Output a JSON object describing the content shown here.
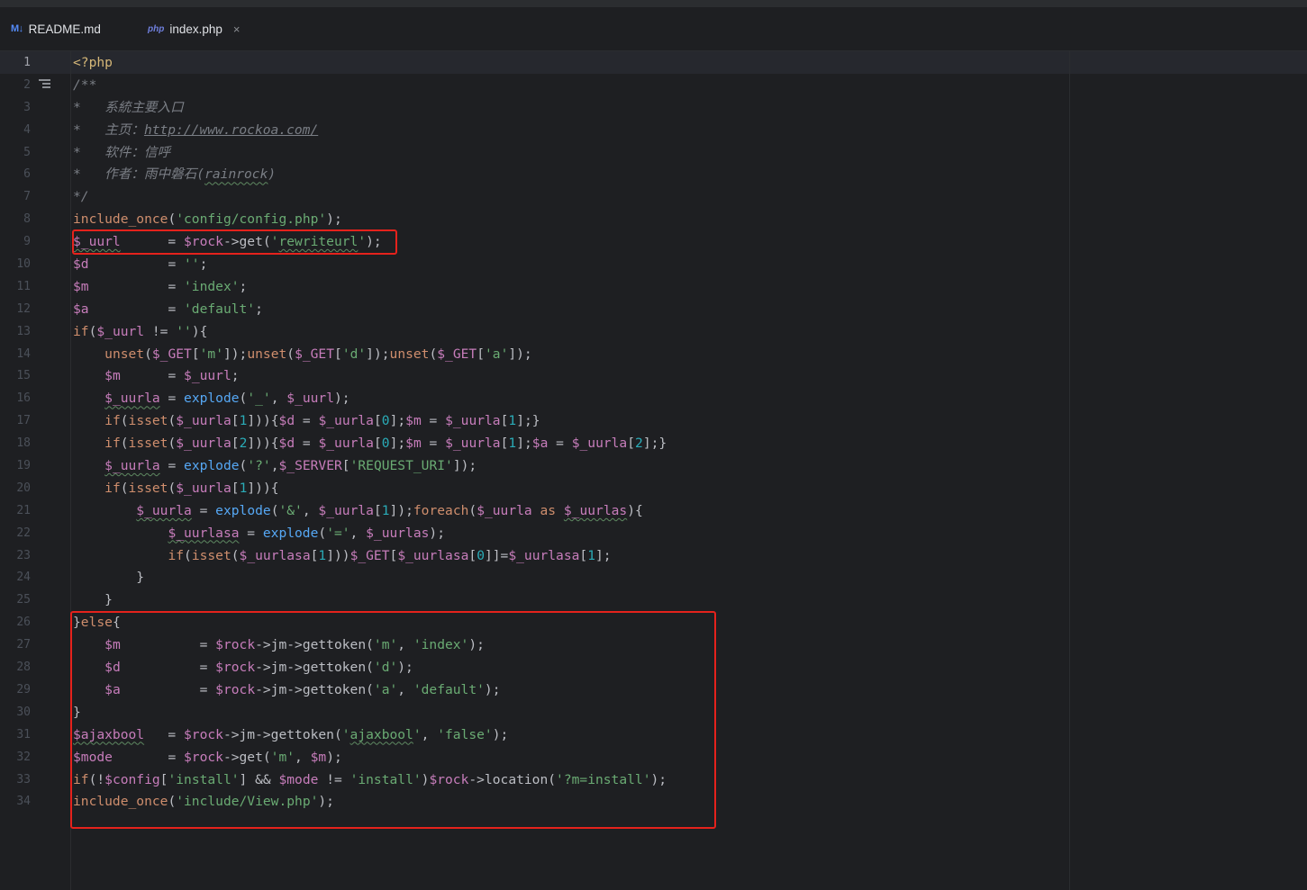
{
  "tabs": [
    {
      "icon": "M↓",
      "label": "README.md",
      "active": false
    },
    {
      "icon": "php",
      "label": "index.php",
      "active": true,
      "close": "×"
    }
  ],
  "editor": {
    "current_line": 1,
    "lines": [
      {
        "n": "1",
        "tokens": [
          [
            "tag",
            "<?php"
          ]
        ]
      },
      {
        "n": "2",
        "fold": true,
        "tokens": [
          [
            "com",
            "/**"
          ]
        ]
      },
      {
        "n": "3",
        "tokens": [
          [
            "com",
            "*   系統主要入口"
          ]
        ]
      },
      {
        "n": "4",
        "tokens": [
          [
            "com",
            "*   主页："
          ],
          [
            "link",
            "http://www.rockoa.com/"
          ]
        ]
      },
      {
        "n": "5",
        "tokens": [
          [
            "com",
            "*   软件：信呼"
          ]
        ]
      },
      {
        "n": "6",
        "tokens": [
          [
            "com",
            "*   作者：雨中磐石("
          ],
          [
            "linkplain",
            "rainrock"
          ],
          [
            "com",
            ")"
          ]
        ]
      },
      {
        "n": "7",
        "tokens": [
          [
            "com",
            "*/"
          ]
        ]
      },
      {
        "n": "8",
        "tokens": [
          [
            "kw",
            "include_once"
          ],
          [
            "p",
            "("
          ],
          [
            "str",
            "'config/config.php'"
          ],
          [
            "p",
            ");"
          ]
        ]
      },
      {
        "n": "9",
        "tokens": [
          [
            "vsq",
            "$_uurl"
          ],
          [
            "p",
            "      = "
          ],
          [
            "var",
            "$rock"
          ],
          [
            "p",
            "->get("
          ],
          [
            "str",
            "'"
          ],
          [
            "strsq",
            "rewriteurl"
          ],
          [
            "str",
            "'"
          ],
          [
            "p",
            ");"
          ]
        ]
      },
      {
        "n": "10",
        "tokens": [
          [
            "var",
            "$d"
          ],
          [
            "p",
            "          = "
          ],
          [
            "str",
            "''"
          ],
          [
            "p",
            ";"
          ]
        ]
      },
      {
        "n": "11",
        "tokens": [
          [
            "var",
            "$m"
          ],
          [
            "p",
            "          = "
          ],
          [
            "str",
            "'index'"
          ],
          [
            "p",
            ";"
          ]
        ]
      },
      {
        "n": "12",
        "tokens": [
          [
            "var",
            "$a"
          ],
          [
            "p",
            "          = "
          ],
          [
            "str",
            "'default'"
          ],
          [
            "p",
            ";"
          ]
        ]
      },
      {
        "n": "13",
        "tokens": [
          [
            "kw",
            "if"
          ],
          [
            "p",
            "("
          ],
          [
            "var",
            "$_uurl"
          ],
          [
            "p",
            " != "
          ],
          [
            "str",
            "''"
          ],
          [
            "p",
            "){"
          ]
        ]
      },
      {
        "n": "14",
        "tokens": [
          [
            "p",
            "    "
          ],
          [
            "kw",
            "unset"
          ],
          [
            "p",
            "("
          ],
          [
            "var",
            "$_GET"
          ],
          [
            "p",
            "["
          ],
          [
            "str",
            "'m'"
          ],
          [
            "p",
            "]);"
          ],
          [
            "kw",
            "unset"
          ],
          [
            "p",
            "("
          ],
          [
            "var",
            "$_GET"
          ],
          [
            "p",
            "["
          ],
          [
            "str",
            "'d'"
          ],
          [
            "p",
            "]);"
          ],
          [
            "kw",
            "unset"
          ],
          [
            "p",
            "("
          ],
          [
            "var",
            "$_GET"
          ],
          [
            "p",
            "["
          ],
          [
            "str",
            "'a'"
          ],
          [
            "p",
            "]);"
          ]
        ]
      },
      {
        "n": "15",
        "tokens": [
          [
            "p",
            "    "
          ],
          [
            "var",
            "$m"
          ],
          [
            "p",
            "      = "
          ],
          [
            "var",
            "$_uurl"
          ],
          [
            "p",
            ";"
          ]
        ]
      },
      {
        "n": "16",
        "tokens": [
          [
            "p",
            "    "
          ],
          [
            "vsq",
            "$_uurla"
          ],
          [
            "p",
            " = "
          ],
          [
            "fn",
            "explode"
          ],
          [
            "p",
            "("
          ],
          [
            "str",
            "'_'"
          ],
          [
            "p",
            ", "
          ],
          [
            "var",
            "$_uurl"
          ],
          [
            "p",
            ");"
          ]
        ]
      },
      {
        "n": "17",
        "tokens": [
          [
            "p",
            "    "
          ],
          [
            "kw",
            "if"
          ],
          [
            "p",
            "("
          ],
          [
            "kw",
            "isset"
          ],
          [
            "p",
            "("
          ],
          [
            "var",
            "$_uurla"
          ],
          [
            "p",
            "["
          ],
          [
            "num",
            "1"
          ],
          [
            "p",
            "])){"
          ],
          [
            "var",
            "$d"
          ],
          [
            "p",
            " = "
          ],
          [
            "var",
            "$_uurla"
          ],
          [
            "p",
            "["
          ],
          [
            "num",
            "0"
          ],
          [
            "p",
            "];"
          ],
          [
            "var",
            "$m"
          ],
          [
            "p",
            " = "
          ],
          [
            "var",
            "$_uurla"
          ],
          [
            "p",
            "["
          ],
          [
            "num",
            "1"
          ],
          [
            "p",
            "];}"
          ]
        ]
      },
      {
        "n": "18",
        "tokens": [
          [
            "p",
            "    "
          ],
          [
            "kw",
            "if"
          ],
          [
            "p",
            "("
          ],
          [
            "kw",
            "isset"
          ],
          [
            "p",
            "("
          ],
          [
            "var",
            "$_uurla"
          ],
          [
            "p",
            "["
          ],
          [
            "num",
            "2"
          ],
          [
            "p",
            "])){"
          ],
          [
            "var",
            "$d"
          ],
          [
            "p",
            " = "
          ],
          [
            "var",
            "$_uurla"
          ],
          [
            "p",
            "["
          ],
          [
            "num",
            "0"
          ],
          [
            "p",
            "];"
          ],
          [
            "var",
            "$m"
          ],
          [
            "p",
            " = "
          ],
          [
            "var",
            "$_uurla"
          ],
          [
            "p",
            "["
          ],
          [
            "num",
            "1"
          ],
          [
            "p",
            "];"
          ],
          [
            "var",
            "$a"
          ],
          [
            "p",
            " = "
          ],
          [
            "var",
            "$_uurla"
          ],
          [
            "p",
            "["
          ],
          [
            "num",
            "2"
          ],
          [
            "p",
            "];}"
          ]
        ]
      },
      {
        "n": "19",
        "tokens": [
          [
            "p",
            "    "
          ],
          [
            "vsq",
            "$_uurla"
          ],
          [
            "p",
            " = "
          ],
          [
            "fn",
            "explode"
          ],
          [
            "p",
            "("
          ],
          [
            "str",
            "'?'"
          ],
          [
            "p",
            ","
          ],
          [
            "var",
            "$_SERVER"
          ],
          [
            "p",
            "["
          ],
          [
            "str",
            "'REQUEST_URI'"
          ],
          [
            "p",
            "]);"
          ]
        ]
      },
      {
        "n": "20",
        "tokens": [
          [
            "p",
            "    "
          ],
          [
            "kw",
            "if"
          ],
          [
            "p",
            "("
          ],
          [
            "kw",
            "isset"
          ],
          [
            "p",
            "("
          ],
          [
            "var",
            "$_uurla"
          ],
          [
            "p",
            "["
          ],
          [
            "num",
            "1"
          ],
          [
            "p",
            "])){"
          ]
        ]
      },
      {
        "n": "21",
        "tokens": [
          [
            "p",
            "        "
          ],
          [
            "vsq",
            "$_uurla"
          ],
          [
            "p",
            " = "
          ],
          [
            "fn",
            "explode"
          ],
          [
            "p",
            "("
          ],
          [
            "str",
            "'&'"
          ],
          [
            "p",
            ", "
          ],
          [
            "var",
            "$_uurla"
          ],
          [
            "p",
            "["
          ],
          [
            "num",
            "1"
          ],
          [
            "p",
            "]);"
          ],
          [
            "kw",
            "foreach"
          ],
          [
            "p",
            "("
          ],
          [
            "var",
            "$_uurla"
          ],
          [
            "p",
            " "
          ],
          [
            "kw",
            "as"
          ],
          [
            "p",
            " "
          ],
          [
            "vsq",
            "$_uurlas"
          ],
          [
            "p",
            "){"
          ]
        ]
      },
      {
        "n": "22",
        "tokens": [
          [
            "p",
            "            "
          ],
          [
            "vsq",
            "$_uurlasa"
          ],
          [
            "p",
            " = "
          ],
          [
            "fn",
            "explode"
          ],
          [
            "p",
            "("
          ],
          [
            "str",
            "'='"
          ],
          [
            "p",
            ", "
          ],
          [
            "var",
            "$_uurlas"
          ],
          [
            "p",
            ");"
          ]
        ]
      },
      {
        "n": "23",
        "tokens": [
          [
            "p",
            "            "
          ],
          [
            "kw",
            "if"
          ],
          [
            "p",
            "("
          ],
          [
            "kw",
            "isset"
          ],
          [
            "p",
            "("
          ],
          [
            "var",
            "$_uurlasa"
          ],
          [
            "p",
            "["
          ],
          [
            "num",
            "1"
          ],
          [
            "p",
            "]))"
          ],
          [
            "var",
            "$_GET"
          ],
          [
            "p",
            "["
          ],
          [
            "var",
            "$_uurlasa"
          ],
          [
            "p",
            "["
          ],
          [
            "num",
            "0"
          ],
          [
            "p",
            "]]="
          ],
          [
            "var",
            "$_uurlasa"
          ],
          [
            "p",
            "["
          ],
          [
            "num",
            "1"
          ],
          [
            "p",
            "];"
          ]
        ]
      },
      {
        "n": "24",
        "tokens": [
          [
            "p",
            "        }"
          ]
        ]
      },
      {
        "n": "25",
        "tokens": [
          [
            "p",
            "    }"
          ]
        ]
      },
      {
        "n": "26",
        "tokens": [
          [
            "p",
            "}"
          ],
          [
            "kw",
            "else"
          ],
          [
            "p",
            "{"
          ]
        ]
      },
      {
        "n": "27",
        "tokens": [
          [
            "p",
            "    "
          ],
          [
            "var",
            "$m"
          ],
          [
            "p",
            "          = "
          ],
          [
            "var",
            "$rock"
          ],
          [
            "p",
            "->jm->gettoken("
          ],
          [
            "str",
            "'m'"
          ],
          [
            "p",
            ", "
          ],
          [
            "str",
            "'index'"
          ],
          [
            "p",
            ");"
          ]
        ]
      },
      {
        "n": "28",
        "tokens": [
          [
            "p",
            "    "
          ],
          [
            "var",
            "$d"
          ],
          [
            "p",
            "          = "
          ],
          [
            "var",
            "$rock"
          ],
          [
            "p",
            "->jm->gettoken("
          ],
          [
            "str",
            "'d'"
          ],
          [
            "p",
            ");"
          ]
        ]
      },
      {
        "n": "29",
        "tokens": [
          [
            "p",
            "    "
          ],
          [
            "var",
            "$a"
          ],
          [
            "p",
            "          = "
          ],
          [
            "var",
            "$rock"
          ],
          [
            "p",
            "->jm->gettoken("
          ],
          [
            "str",
            "'a'"
          ],
          [
            "p",
            ", "
          ],
          [
            "str",
            "'default'"
          ],
          [
            "p",
            ");"
          ]
        ]
      },
      {
        "n": "30",
        "tokens": [
          [
            "p",
            "}"
          ]
        ]
      },
      {
        "n": "31",
        "tokens": [
          [
            "vsq",
            "$ajaxbool"
          ],
          [
            "p",
            "   = "
          ],
          [
            "var",
            "$rock"
          ],
          [
            "p",
            "->jm->gettoken("
          ],
          [
            "str",
            "'"
          ],
          [
            "strsq",
            "ajaxbool"
          ],
          [
            "str",
            "'"
          ],
          [
            "p",
            ", "
          ],
          [
            "str",
            "'false'"
          ],
          [
            "p",
            ");"
          ]
        ]
      },
      {
        "n": "32",
        "tokens": [
          [
            "var",
            "$mode"
          ],
          [
            "p",
            "       = "
          ],
          [
            "var",
            "$rock"
          ],
          [
            "p",
            "->get("
          ],
          [
            "str",
            "'m'"
          ],
          [
            "p",
            ", "
          ],
          [
            "var",
            "$m"
          ],
          [
            "p",
            ");"
          ]
        ]
      },
      {
        "n": "33",
        "tokens": [
          [
            "kw",
            "if"
          ],
          [
            "p",
            "(!"
          ],
          [
            "var",
            "$config"
          ],
          [
            "p",
            "["
          ],
          [
            "str",
            "'install'"
          ],
          [
            "p",
            "] && "
          ],
          [
            "var",
            "$mode"
          ],
          [
            "p",
            " != "
          ],
          [
            "str",
            "'install'"
          ],
          [
            "p",
            ")"
          ],
          [
            "var",
            "$rock"
          ],
          [
            "p",
            "->location("
          ],
          [
            "str",
            "'?m=install'"
          ],
          [
            "p",
            ");"
          ]
        ]
      },
      {
        "n": "34",
        "tokens": [
          [
            "kw",
            "include_once"
          ],
          [
            "p",
            "("
          ],
          [
            "str",
            "'include/View.php'"
          ],
          [
            "p",
            ");"
          ]
        ]
      }
    ]
  },
  "annotations": {
    "box_color": "#e5221c"
  },
  "colors": {
    "background": "#1e1f22",
    "keyword": "#cf8e6d",
    "string": "#6aab73",
    "variable": "#c77dbb",
    "number": "#2aacb8",
    "function": "#56a8f5",
    "comment": "#7a7e85",
    "php_tag": "#d5b778",
    "tab_underline": "#3574f0"
  }
}
